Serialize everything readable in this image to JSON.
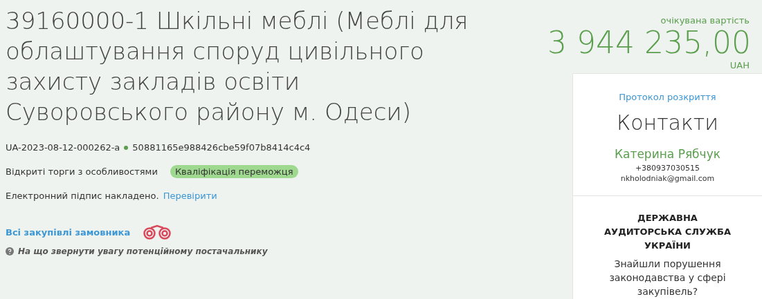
{
  "title": "39160000-1 Шкільні меблі (Меблі для облаштування споруд цивільного захисту закладів освіти Суворовського району м. Одеси)",
  "tender_id": "UA-2023-08-12-000262-a",
  "hash": "50881165e988426cbe59f07b8414c4c4",
  "procedure": "Відкриті торги з особливостями",
  "status": "Кваліфікація переможця",
  "signature": {
    "text": "Електронний підпис накладено.",
    "link": "Перевірити"
  },
  "customer_link": "Всі закупівлі замовника",
  "hint": "На що звернути увагу потенційному постачальнику",
  "price": {
    "label": "очікувана вартість",
    "amount": "3 944 235,00",
    "currency": "UAH"
  },
  "contacts": {
    "protocol_link": "Протокол розкриття",
    "heading": "Контакти",
    "name": "Катерина Рябчук",
    "phone": "+380937030515",
    "email": "nkholodniak@gmail.com"
  },
  "audit": {
    "title": "ДЕРЖАВНА АУДИТОРСЬКА СЛУЖБА УКРАЇНИ",
    "text": "Знайшли порушення законодавства у сфері закупівель?"
  }
}
